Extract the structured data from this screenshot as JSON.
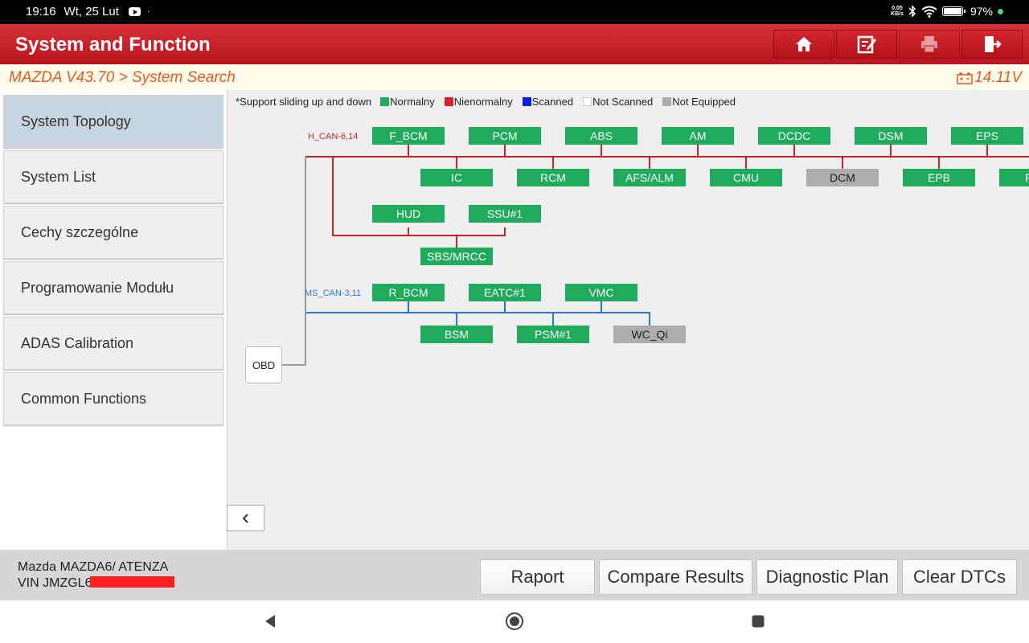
{
  "status_bar": {
    "time": "19:16",
    "date": "Wt, 25 Lut",
    "network_speed_value": "0,05",
    "network_speed_unit": "KB/s",
    "battery": "97%"
  },
  "header": {
    "title": "System and Function",
    "buttons": [
      {
        "icon": "home-icon"
      },
      {
        "icon": "edit-icon"
      },
      {
        "icon": "print-icon"
      },
      {
        "icon": "exit-icon"
      }
    ]
  },
  "breadcrumb": {
    "text": "MAZDA V43.70 > System Search",
    "voltage": "14.11V"
  },
  "sidebar": {
    "items": [
      {
        "label": "System Topology",
        "active": true
      },
      {
        "label": "System List"
      },
      {
        "label": "Cechy szczególne"
      },
      {
        "label": "Programowanie Modułu"
      },
      {
        "label": "ADAS Calibration"
      },
      {
        "label": "Common Functions"
      }
    ]
  },
  "legend": {
    "hint": "*Support sliding up and down",
    "items": [
      {
        "label": "Normalny",
        "color": "#1faa5c"
      },
      {
        "label": "Nienormalny",
        "color": "#d5232f"
      },
      {
        "label": "Scanned",
        "color": "#0a1fe0"
      },
      {
        "label": "Not Scanned",
        "color": "#ffffff"
      },
      {
        "label": "Not Equipped",
        "color": "#adadad"
      }
    ]
  },
  "topology": {
    "buses": [
      {
        "label": "H_CAN-6,14",
        "color": "#c0262e"
      },
      {
        "label": "MS_CAN-3,11",
        "color": "#2f78bf"
      }
    ],
    "obd_label": "OBD",
    "modules": {
      "f_bcm": "F_BCM",
      "pcm": "PCM",
      "abs": "ABS",
      "am": "AM",
      "dcdc": "DCDC",
      "dsm": "DSM",
      "eps": "EPS",
      "ic": "IC",
      "rcm": "RCM",
      "afs_alm": "AFS/ALM",
      "cmu": "CMU",
      "dcm": "DCM",
      "epb": "EPB",
      "partial": "F",
      "hud": "HUD",
      "ssu1": "SSU#1",
      "sbs_mrcc": "SBS/MRCC",
      "r_bcm": "R_BCM",
      "eatc1": "EATC#1",
      "vmc": "VMC",
      "bsm": "BSM",
      "psm1": "PSM#1",
      "wc_qi": "WC_Qi"
    },
    "status_colors": {
      "normal": "#1faa5c",
      "not_equipped": "#adadad"
    }
  },
  "footer": {
    "vehicle": "Mazda MAZDA6/ ATENZA",
    "vin": "VIN JMZGL6",
    "buttons": {
      "report": "Raport",
      "compare": "Compare Results",
      "plan": "Diagnostic Plan",
      "clear": "Clear DTCs"
    }
  },
  "nav_bar": {
    "back": "back-icon",
    "home": "home-circle-icon",
    "recents": "recents-icon"
  }
}
